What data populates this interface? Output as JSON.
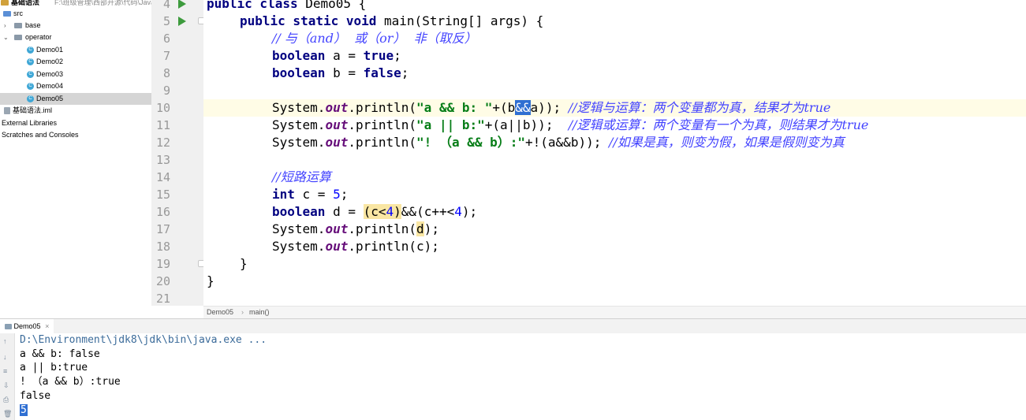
{
  "tree": {
    "project_name": "基础语法",
    "project_path": "F:\\班级管理\\西部开源\\代码\\JavaSE\\基础",
    "items": [
      {
        "label": "src"
      },
      {
        "label": "base"
      },
      {
        "label": "operator"
      },
      {
        "label": "Demo01"
      },
      {
        "label": "Demo02"
      },
      {
        "label": "Demo03"
      },
      {
        "label": "Demo04"
      },
      {
        "label": "Demo05"
      },
      {
        "label": "基础语法.iml"
      },
      {
        "label": "External Libraries"
      },
      {
        "label": "Scratches and Consoles"
      }
    ]
  },
  "editor": {
    "line_numbers": [
      "4",
      "5",
      "6",
      "7",
      "8",
      "9",
      "10",
      "11",
      "12",
      "13",
      "14",
      "15",
      "16",
      "17",
      "18",
      "19",
      "20",
      "21"
    ],
    "code": {
      "l4_kw": "public class",
      "l4_rest": " Demo05 {",
      "l5_kw": "public static void",
      "l5_rest": " main(String[] args) {",
      "l6_cmt": "// 与（and）  或（or）  非（取反）",
      "l7_kw": "boolean",
      "l7_mid": " a = ",
      "l7_val": "true",
      "l7_end": ";",
      "l8_kw": "boolean",
      "l8_mid": " b = ",
      "l8_val": "false",
      "l8_end": ";",
      "l10_a": "System.",
      "l10_out": "out",
      "l10_b": ".println(",
      "l10_str": "\"a && b: \"",
      "l10_c": "+(b",
      "l10_sel": "&&",
      "l10_d": "a)); ",
      "l10_cmt": "//逻辑与运算：两个变量都为真，结果才为true",
      "l11_a": "System.",
      "l11_out": "out",
      "l11_b": ".println(",
      "l11_str": "\"a || b:\"",
      "l11_c": "+(a||b));  ",
      "l11_cmt": "//逻辑或运算：两个变量有一个为真，则结果才为true",
      "l12_a": "System.",
      "l12_out": "out",
      "l12_b": ".println(",
      "l12_str": "\"! （a && b）:\"",
      "l12_c": "+!(a&&b)); ",
      "l12_cmt": "//如果是真，则变为假，如果是假则变为真",
      "l14_cmt": "//短路运算",
      "l15_kw": "int",
      "l15_mid": " c = ",
      "l15_num": "5",
      "l15_end": ";",
      "l16_kw": "boolean",
      "l16_mid": " d = ",
      "l16_a": "(c<",
      "l16_num1": "4",
      "l16_b": ")",
      "l16_c": "&&(c++<",
      "l16_num2": "4",
      "l16_d": ");",
      "l17_a": "System.",
      "l17_out": "out",
      "l17_b": ".println(",
      "l17_d": "d",
      "l17_c": ");",
      "l18_a": "System.",
      "l18_out": "out",
      "l18_b": ".println(c);",
      "l19": "}",
      "l20": "}"
    },
    "breadcrumb": [
      "Demo05",
      "main()"
    ]
  },
  "run": {
    "tab_label": "Demo05",
    "tab_close": "×",
    "output": [
      "D:\\Environment\\jdk8\\jdk\\bin\\java.exe ...",
      "a && b: false",
      "a || b:true",
      "! （a && b）:true",
      "false",
      "5"
    ]
  },
  "colors": {
    "keyword": "#000080",
    "string": "#067d17",
    "comment": "#4343ff",
    "run_icon": "#3d9b3d",
    "selection": "#2f6fd2"
  }
}
